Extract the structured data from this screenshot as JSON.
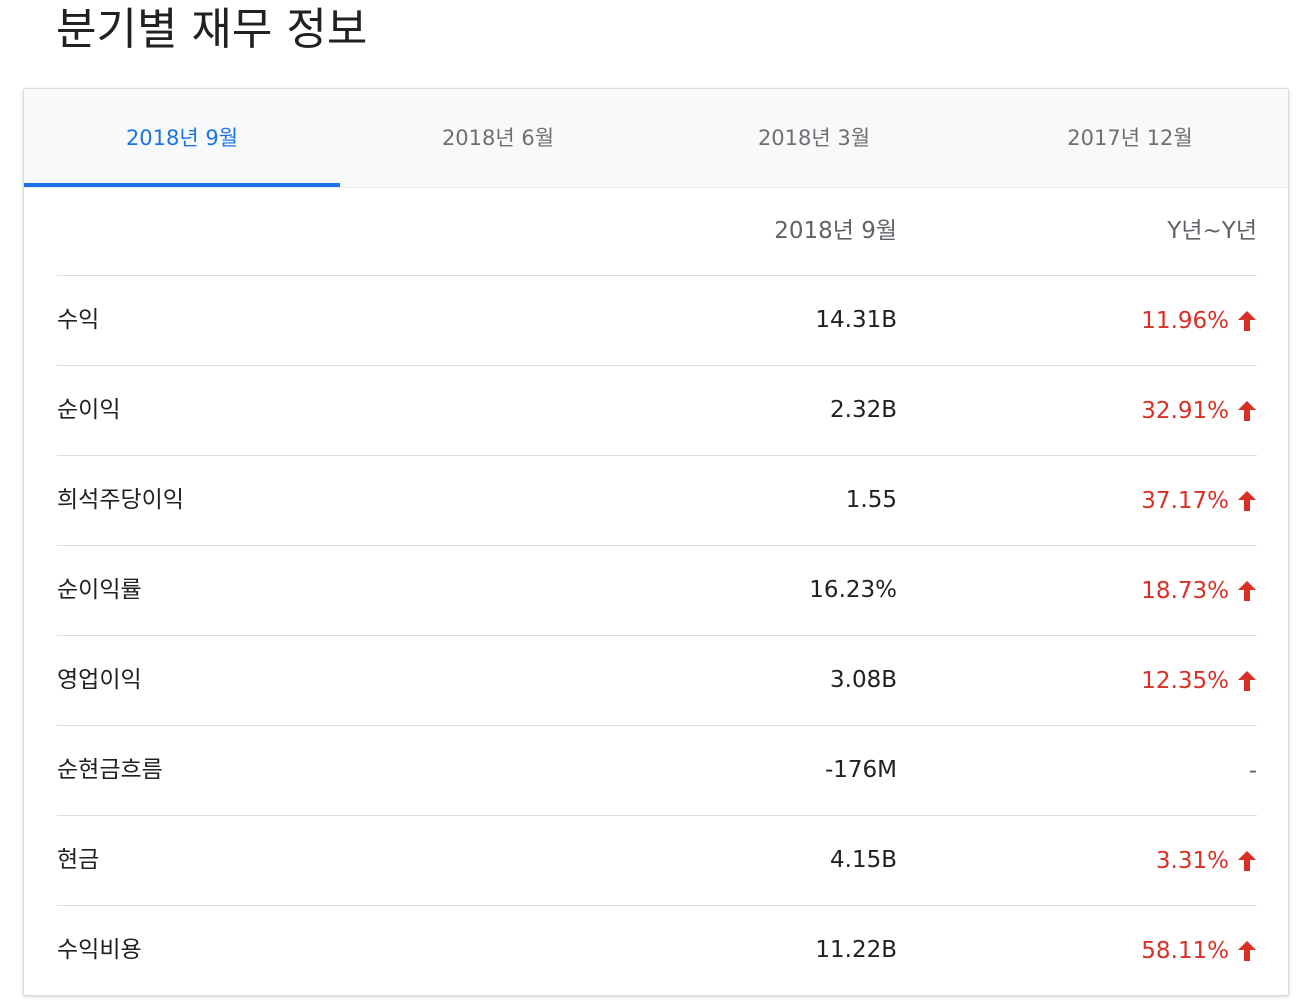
{
  "page": {
    "title": "분기별 재무 정보"
  },
  "tabs": [
    {
      "label": "2018년 9월",
      "active": true
    },
    {
      "label": "2018년 6월",
      "active": false
    },
    {
      "label": "2018년 3월",
      "active": false
    },
    {
      "label": "2017년 12월",
      "active": false
    }
  ],
  "table": {
    "columns": {
      "value": "2018년 9월",
      "change": "Y년~Y년"
    },
    "rows": [
      {
        "label": "수익",
        "value": "14.31B",
        "change": "11.96%",
        "direction": "up"
      },
      {
        "label": "순이익",
        "value": "2.32B",
        "change": "32.91%",
        "direction": "up"
      },
      {
        "label": "희석주당이익",
        "value": "1.55",
        "change": "37.17%",
        "direction": "up"
      },
      {
        "label": "순이익률",
        "value": "16.23%",
        "change": "18.73%",
        "direction": "up"
      },
      {
        "label": "영업이익",
        "value": "3.08B",
        "change": "12.35%",
        "direction": "up"
      },
      {
        "label": "순현금흐름",
        "value": "-176M",
        "change": "-",
        "direction": "none"
      },
      {
        "label": "현금",
        "value": "4.15B",
        "change": "3.31%",
        "direction": "up"
      },
      {
        "label": "수익비용",
        "value": "11.22B",
        "change": "58.11%",
        "direction": "up"
      }
    ]
  },
  "colors": {
    "accent": "#1a73e8",
    "positive_change": "#d93025",
    "text_primary": "#202124",
    "text_secondary": "#5f6368",
    "divider": "#dadce0"
  },
  "icons": {
    "increase": "arrow-up-icon"
  }
}
